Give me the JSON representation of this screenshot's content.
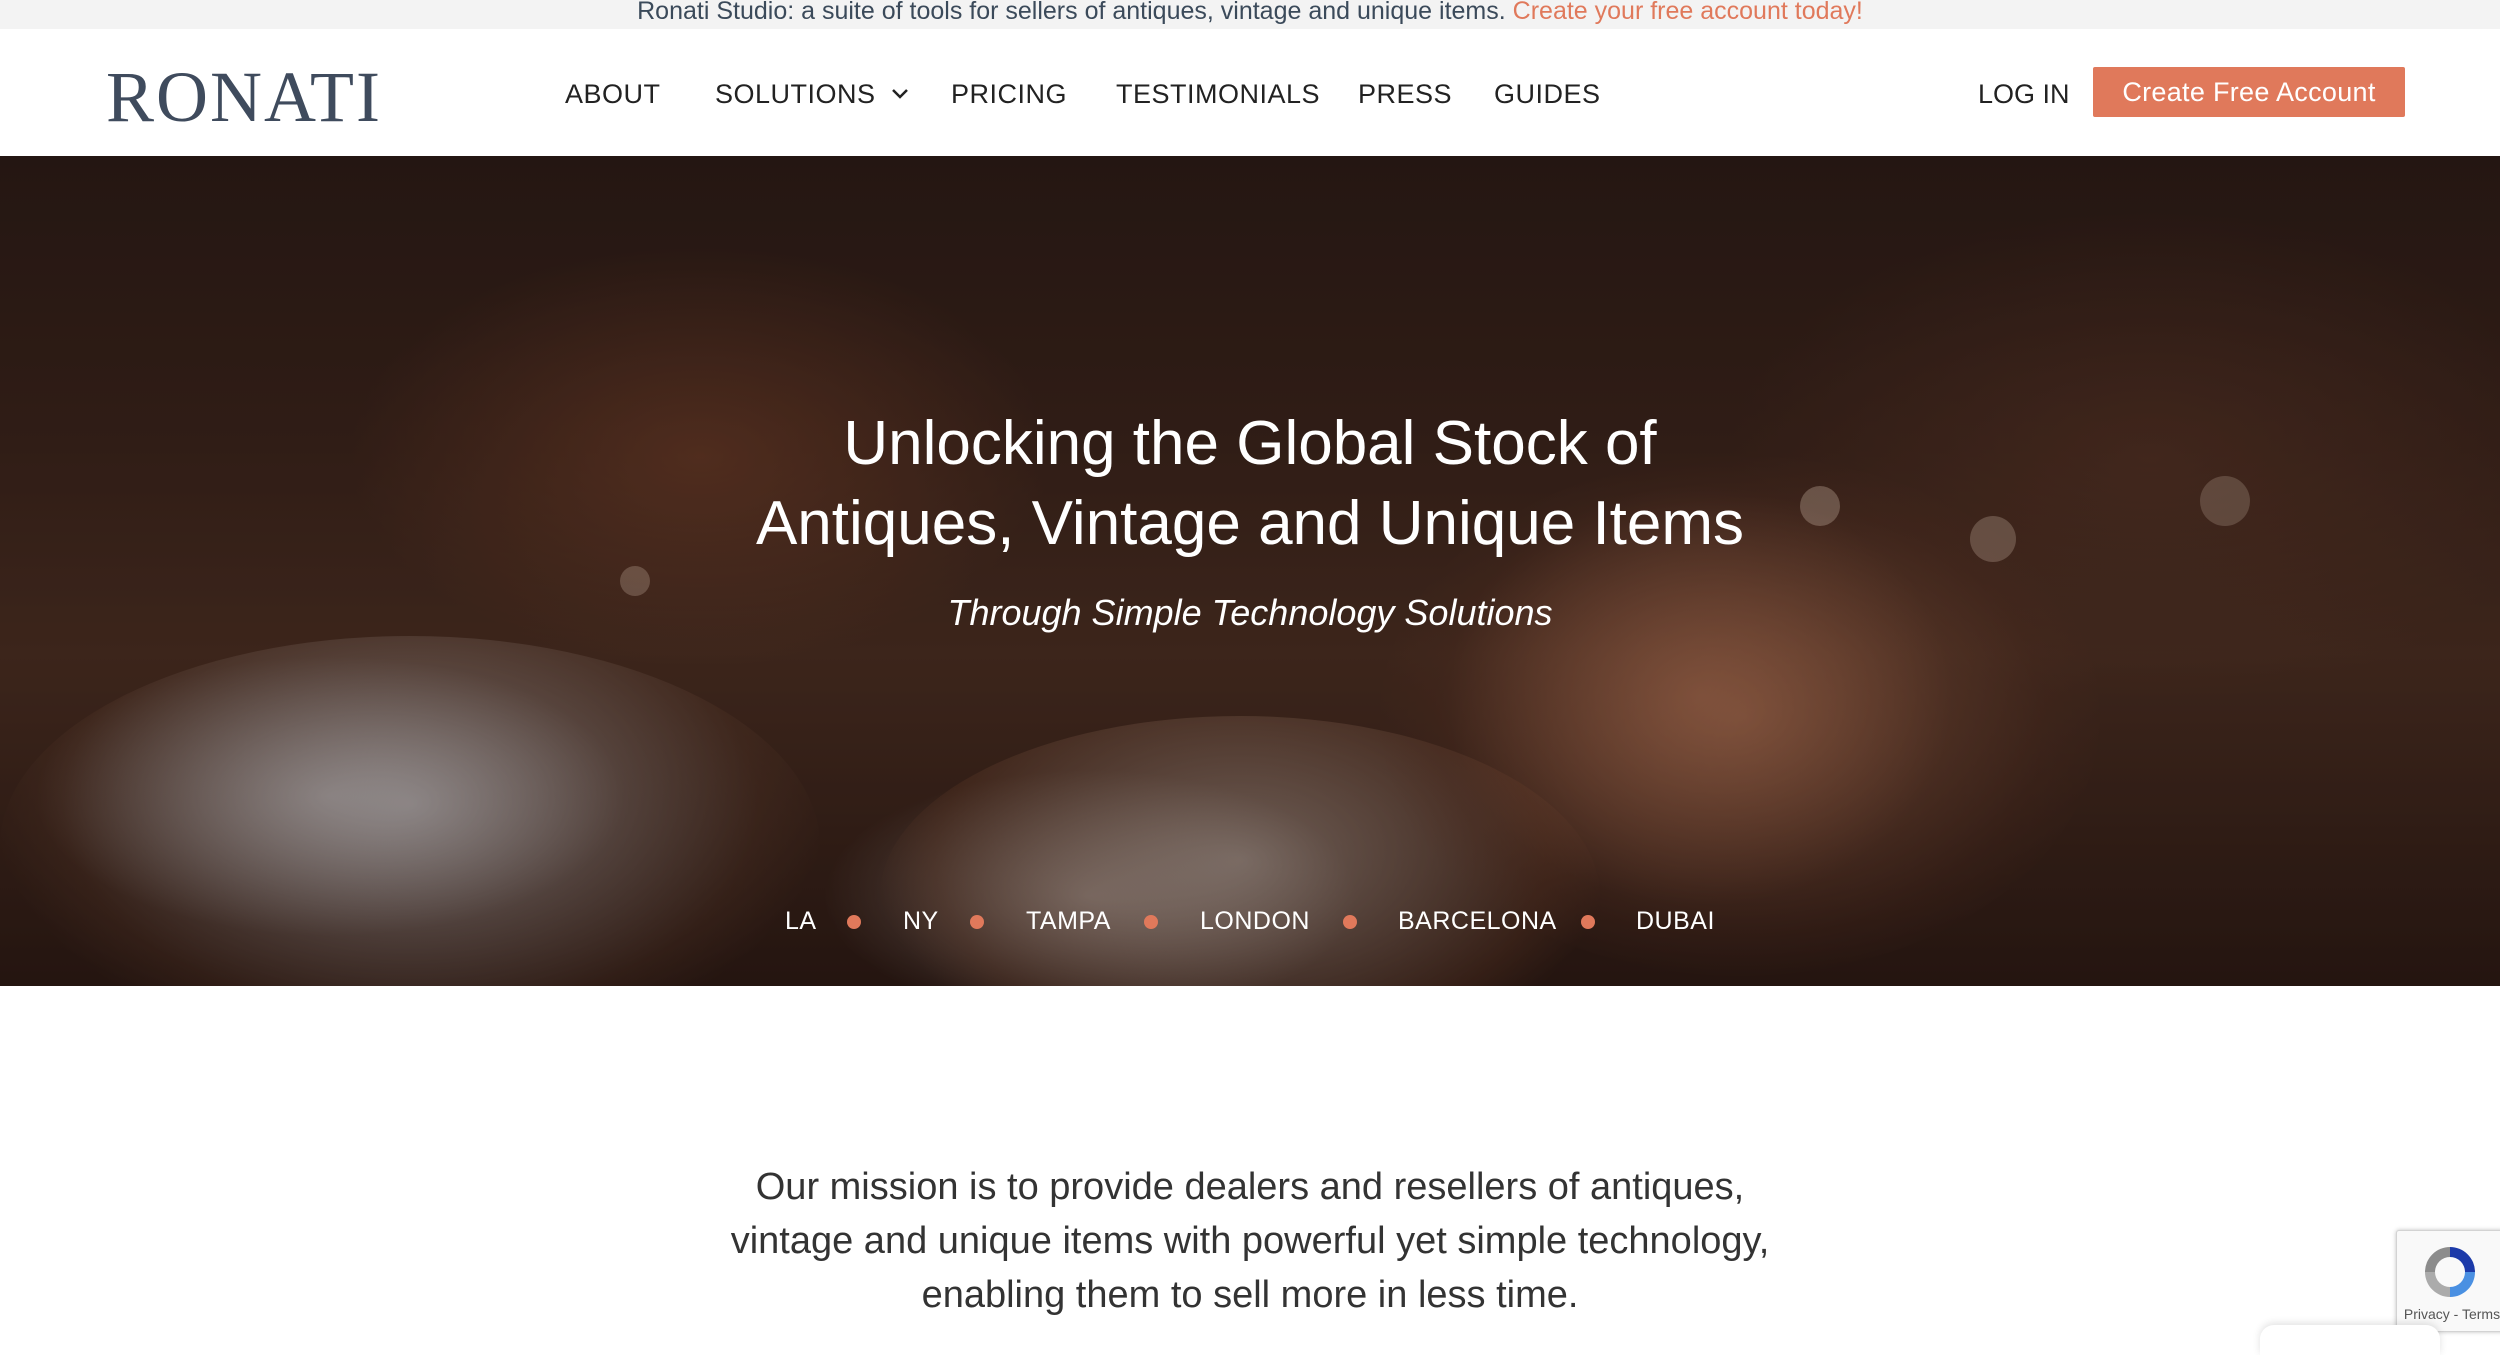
{
  "announcement": {
    "text": "Ronati Studio: a suite of tools for sellers of antiques, vintage and unique items.",
    "cta": "Create your free account today!"
  },
  "header": {
    "logo": "RONATI",
    "nav": {
      "about": "ABOUT",
      "solutions": "SOLUTIONS",
      "pricing": "PRICING",
      "testimonials": "TESTIMONIALS",
      "press": "PRESS",
      "guides": "GUIDES"
    },
    "login": "LOG IN",
    "cta": "Create Free Account"
  },
  "hero": {
    "title": "Unlocking the Global Stock of\nAntiques, Vintage and Unique Items",
    "subtitle": "Through Simple Technology Solutions",
    "cities": [
      "LA",
      "NY",
      "TAMPA",
      "LONDON",
      "BARCELONA",
      "DUBAI"
    ]
  },
  "mission": {
    "text": "Our mission is to provide dealers and resellers of antiques,\nvintage and unique items with powerful yet simple technology,\nenabling them to sell more in less time."
  },
  "recaptcha": {
    "links": "Privacy - Terms"
  },
  "colors": {
    "accent": "#e0795b",
    "logo": "#3f4b5d",
    "announcement_bg": "#f3f3f3"
  }
}
